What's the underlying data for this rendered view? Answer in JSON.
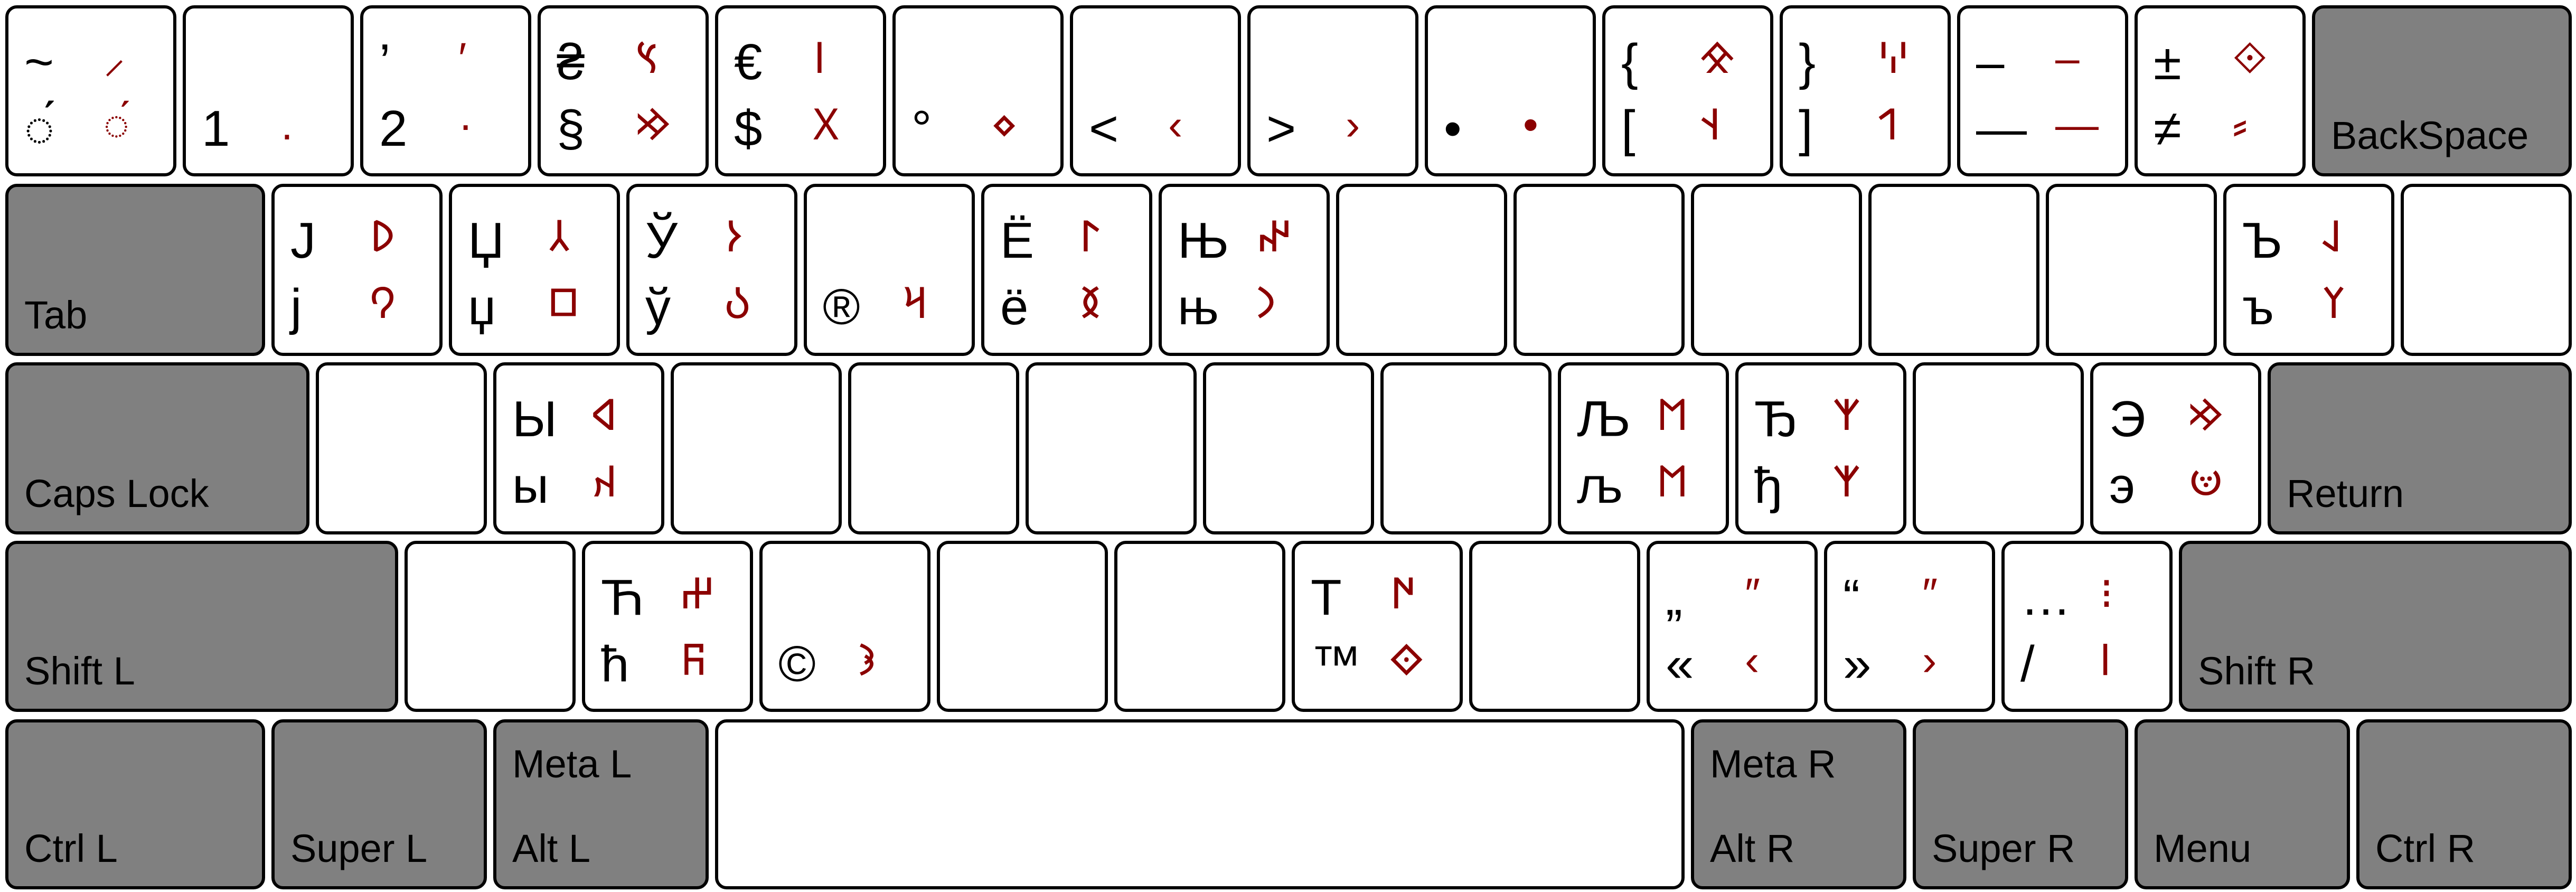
{
  "colors": {
    "primary": "#000000",
    "secondary": "#8b0000",
    "modifier_key": "#808080",
    "key": "#ffffff"
  },
  "rows": [
    [
      {
        "id": "grave",
        "shift": "~",
        "shift_alt": "⸝",
        "base": "◌́",
        "base_alt": "◌́"
      },
      {
        "id": "digit-1",
        "shift": "",
        "shift_alt": "",
        "base": "1",
        "base_alt": "."
      },
      {
        "id": "digit-2",
        "shift": "’",
        "shift_alt": "′",
        "base": "2",
        "base_alt": "·"
      },
      {
        "id": "digit-3",
        "shift": "₴",
        "shift_alt": "𐰽",
        "base": "§",
        "base_alt": "𐰢"
      },
      {
        "id": "digit-4",
        "shift": "€",
        "shift_alt": "𐰾",
        "base": "$",
        "base_alt": "𐰓"
      },
      {
        "id": "digit-5",
        "shift": "",
        "shift_alt": "",
        "base": "°",
        "base_alt": "⋄"
      },
      {
        "id": "digit-6",
        "shift": "",
        "shift_alt": "",
        "base": "<",
        "base_alt": "‹"
      },
      {
        "id": "digit-7",
        "shift": "",
        "shift_alt": "",
        "base": ">",
        "base_alt": "›"
      },
      {
        "id": "digit-8",
        "shift": "",
        "shift_alt": "",
        "base": "•",
        "base_alt": "•"
      },
      {
        "id": "digit-9",
        "shift": "{",
        "shift_alt": "𐰌",
        "base": "[",
        "base_alt": "𐰭"
      },
      {
        "id": "digit-0",
        "shift": "}",
        "shift_alt": "𐰎",
        "base": "]",
        "base_alt": "𐰯"
      },
      {
        "id": "minus",
        "shift": "–",
        "shift_alt": "–",
        "base": "—",
        "base_alt": "—"
      },
      {
        "id": "equal",
        "shift": "±",
        "shift_alt": "⟐",
        "base": "≠",
        "base_alt": "⸗"
      },
      {
        "id": "backspace",
        "label": "BackSpace"
      }
    ],
    [
      {
        "id": "tab",
        "label": "Tab"
      },
      {
        "id": "q",
        "shift": "J",
        "shift_alt": "𐰖",
        "base": "j",
        "base_alt": "𐰘"
      },
      {
        "id": "w",
        "shift": "Џ",
        "shift_alt": "𐰲",
        "base": "џ",
        "base_alt": "𐰿"
      },
      {
        "id": "e",
        "shift": "Ў",
        "shift_alt": "𐰆",
        "base": "ў",
        "base_alt": "𐰉"
      },
      {
        "id": "r",
        "shift": "",
        "shift_alt": "",
        "base": "®",
        "base_alt": "𐰺"
      },
      {
        "id": "t",
        "shift": "Ё",
        "shift_alt": "𐰃",
        "base": "ё",
        "base_alt": "𐰅"
      },
      {
        "id": "y",
        "shift": "Њ",
        "shift_alt": "𐰤",
        "base": "њ",
        "base_alt": "𐰣"
      },
      {
        "id": "u",
        "shift": "",
        "shift_alt": "",
        "base": "",
        "base_alt": ""
      },
      {
        "id": "i",
        "shift": "",
        "shift_alt": "",
        "base": "",
        "base_alt": ""
      },
      {
        "id": "o",
        "shift": "",
        "shift_alt": "",
        "base": "",
        "base_alt": ""
      },
      {
        "id": "p",
        "shift": "",
        "shift_alt": "",
        "base": "",
        "base_alt": ""
      },
      {
        "id": "bracket-left",
        "shift": "",
        "shift_alt": "",
        "base": "",
        "base_alt": ""
      },
      {
        "id": "bracket-right",
        "shift": "Ъ",
        "shift_alt": "𐰞",
        "base": "ъ",
        "base_alt": "𐰠"
      },
      {
        "id": "backslash",
        "shift": "",
        "shift_alt": "",
        "base": "",
        "base_alt": ""
      }
    ],
    [
      {
        "id": "caps-lock",
        "label": "Caps Lock"
      },
      {
        "id": "a",
        "shift": "",
        "shift_alt": "",
        "base": "",
        "base_alt": ""
      },
      {
        "id": "s",
        "shift": "Ы",
        "shift_alt": "𐰶",
        "base": "ы",
        "base_alt": "𐰴"
      },
      {
        "id": "d",
        "shift": "",
        "shift_alt": "",
        "base": "",
        "base_alt": ""
      },
      {
        "id": "f",
        "shift": "",
        "shift_alt": "",
        "base": "",
        "base_alt": ""
      },
      {
        "id": "g",
        "shift": "",
        "shift_alt": "",
        "base": "",
        "base_alt": ""
      },
      {
        "id": "h",
        "shift": "",
        "shift_alt": "",
        "base": "",
        "base_alt": ""
      },
      {
        "id": "j",
        "shift": "",
        "shift_alt": "",
        "base": "",
        "base_alt": ""
      },
      {
        "id": "k",
        "shift": "Љ",
        "shift_alt": "𐰡",
        "base": "љ",
        "base_alt": "𐰡"
      },
      {
        "id": "l",
        "shift": "Ђ",
        "shift_alt": "𐰱",
        "base": "ђ",
        "base_alt": "𐰱"
      },
      {
        "id": "semicolon",
        "shift": "",
        "shift_alt": "",
        "base": "",
        "base_alt": ""
      },
      {
        "id": "quote",
        "shift": "Э",
        "shift_alt": "𐰢",
        "base": "э",
        "base_alt": "𐰦"
      },
      {
        "id": "return",
        "label": "Return"
      }
    ],
    [
      {
        "id": "shift-l",
        "label": "Shift L"
      },
      {
        "id": "z",
        "shift": "",
        "shift_alt": "",
        "base": "",
        "base_alt": ""
      },
      {
        "id": "x",
        "shift": "Ћ",
        "shift_alt": "𐰔",
        "base": "ћ",
        "base_alt": "𐰜"
      },
      {
        "id": "c",
        "shift": "",
        "shift_alt": "",
        "base": "©",
        "base_alt": "𐰪"
      },
      {
        "id": "v",
        "shift": "",
        "shift_alt": "",
        "base": "",
        "base_alt": ""
      },
      {
        "id": "b",
        "shift": "",
        "shift_alt": "",
        "base": "",
        "base_alt": ""
      },
      {
        "id": "n",
        "shift": "Т",
        "shift_alt": "𐰇",
        "base": "™",
        "base_alt": "𐰬"
      },
      {
        "id": "m",
        "shift": "",
        "shift_alt": "",
        "base": "",
        "base_alt": ""
      },
      {
        "id": "comma",
        "shift": "„",
        "shift_alt": "″",
        "base": "«",
        "base_alt": "‹"
      },
      {
        "id": "period",
        "shift": "“",
        "shift_alt": "″",
        "base": "»",
        "base_alt": "›"
      },
      {
        "id": "slash",
        "shift": "…",
        "shift_alt": "⁝",
        "base": "/",
        "base_alt": "ǀ"
      },
      {
        "id": "shift-r",
        "label": "Shift R"
      }
    ],
    [
      {
        "id": "ctrl-l",
        "label": "Ctrl L"
      },
      {
        "id": "super-l",
        "label": "Super L"
      },
      {
        "id": "alt-l",
        "label": "Alt L",
        "label_top": "Meta L"
      },
      {
        "id": "space",
        "label": ""
      },
      {
        "id": "alt-r",
        "label": "Alt R",
        "label_top": "Meta R"
      },
      {
        "id": "super-r",
        "label": "Super R"
      },
      {
        "id": "menu",
        "label": "Menu"
      },
      {
        "id": "ctrl-r",
        "label": "Ctrl R"
      }
    ]
  ]
}
